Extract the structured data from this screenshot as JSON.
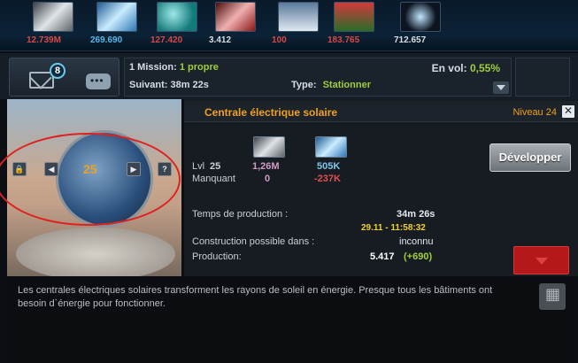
{
  "resources": [
    {
      "name": "metal-resource",
      "value": "12.739M",
      "color": "#d84848",
      "icon_colors": [
        "#6e7378",
        "#dfe4e8"
      ]
    },
    {
      "name": "crystal-resource",
      "value": "269.690",
      "color": "#5ab6e6",
      "icon_colors": [
        "#2f77b6",
        "#c9ecff"
      ]
    },
    {
      "name": "deuterium-resource",
      "value": "127.420",
      "color": "#d84848",
      "icon_colors": [
        "#137a7a",
        "#9de8e6"
      ]
    },
    {
      "name": "energy-resource",
      "value": "3.412",
      "color": "#d8dde2",
      "icon_colors": [
        "#8a1616",
        "#f0b0b0"
      ]
    },
    {
      "name": "population-resource",
      "value": "100",
      "color": "#d84848",
      "icon_colors": [
        "#5b7a9a",
        "#dfe9f2"
      ]
    },
    {
      "name": "food-resource",
      "value": "183.765",
      "color": "#d84848",
      "icon_colors": [
        "#2a6d2a",
        "#d23a3a"
      ]
    },
    {
      "name": "darkmatter-resource",
      "value": "712.657",
      "color": "#d8dde2",
      "icon_colors": [
        "#0c1420",
        "#bfe6ff"
      ]
    }
  ],
  "messages": {
    "unread_count": "8"
  },
  "missions": {
    "count_label": "1 Mission:",
    "own_label": "1 propre",
    "next_label": "Suivant:",
    "next_time": "38m 22s",
    "type_label": "Type:",
    "type_value": "Stationner",
    "flight_label": "En vol:",
    "flight_value": "0,55%"
  },
  "building": {
    "name": "Centrale électrique solaire",
    "niveau_label": "Niveau",
    "niveau_value": "24",
    "close": "✕",
    "selected_level": "25",
    "nav": {
      "lock": "🔒",
      "prev": "◀",
      "next": "▶",
      "help": "?"
    }
  },
  "cost": {
    "lvl_label": "Lvl",
    "lvl_value": "25",
    "manquant_label": "Manquant",
    "metal_cost": "1,26M",
    "metal_missing": "0",
    "crystal_cost": "505K",
    "crystal_missing": "-237K",
    "metal_color": "#d49ac6",
    "crystal_color": "#7cc6ee",
    "missing_color": "#e05050"
  },
  "production": {
    "time_label": "Temps de production :",
    "time_value": "34m 26s",
    "finish_date": "29.11 - 11:58:32",
    "possible_label": "Construction possible dans :",
    "possible_value": "inconnu",
    "production_label": "Production:",
    "production_value": "5.417",
    "production_delta": "(+690)"
  },
  "actions": {
    "develop_label": "Développer"
  },
  "description": "Les centrales électriques solaires transforment les rayons de soleil en énergie. Presque tous les bâtiments ont besoin d`énergie pour fonctionner."
}
